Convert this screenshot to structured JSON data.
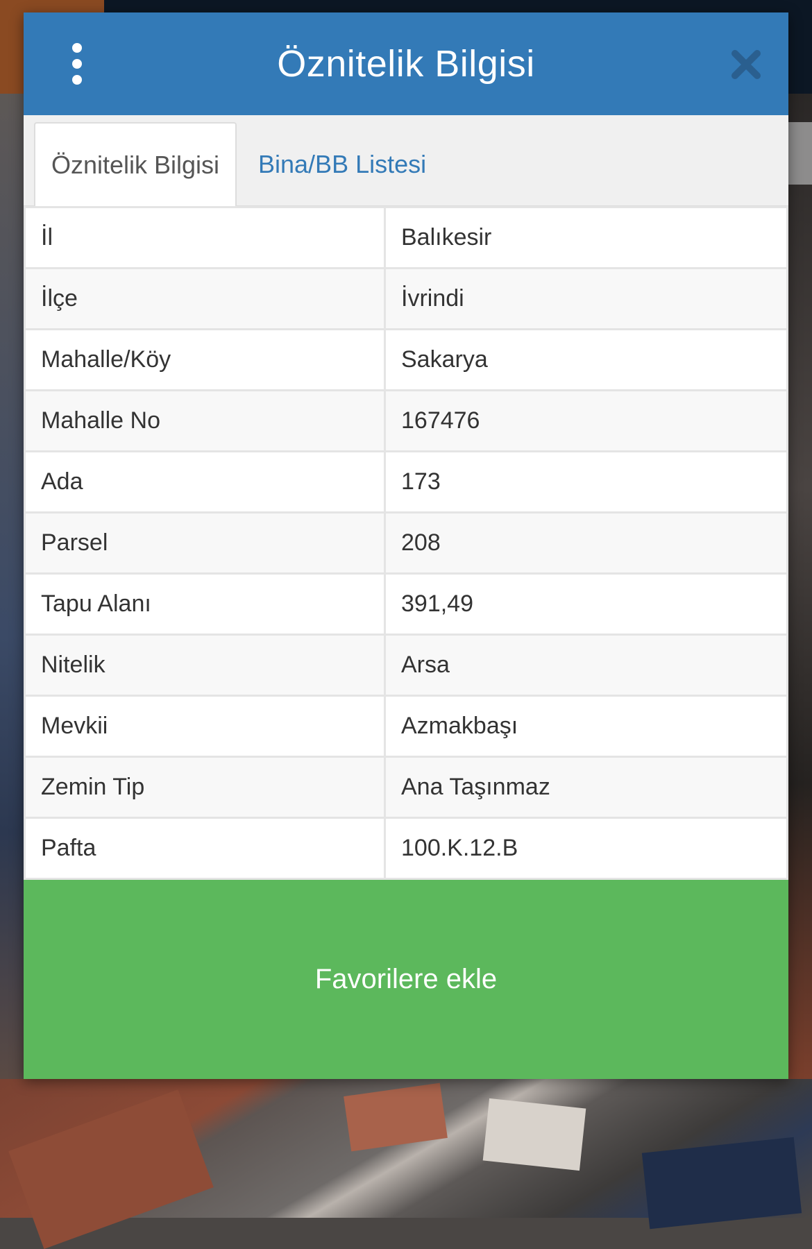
{
  "modal": {
    "title": "Öznitelik Bilgisi",
    "menu_icon": "vertical-ellipsis-icon",
    "close_icon": "close-icon"
  },
  "tabs": [
    {
      "label": "Öznitelik Bilgisi",
      "active": true
    },
    {
      "label": "Bina/BB Listesi",
      "active": false
    }
  ],
  "attributes": [
    {
      "key": "İl",
      "value": "Balıkesir"
    },
    {
      "key": "İlçe",
      "value": "İvrindi"
    },
    {
      "key": "Mahalle/Köy",
      "value": "Sakarya"
    },
    {
      "key": "Mahalle No",
      "value": "167476"
    },
    {
      "key": "Ada",
      "value": "173"
    },
    {
      "key": "Parsel",
      "value": "208"
    },
    {
      "key": "Tapu Alanı",
      "value": "391,49"
    },
    {
      "key": "Nitelik",
      "value": "Arsa"
    },
    {
      "key": "Mevkii",
      "value": "Azmakbaşı"
    },
    {
      "key": "Zemin Tip",
      "value": "Ana Taşınmaz"
    },
    {
      "key": "Pafta",
      "value": "100.K.12.B"
    }
  ],
  "actions": {
    "favorite_label": "Favorilere ekle"
  },
  "colors": {
    "header": "#337ab7",
    "tab_link": "#337ab7",
    "favorite_button": "#5cb85c",
    "close_icon": "#2a5f8f"
  }
}
